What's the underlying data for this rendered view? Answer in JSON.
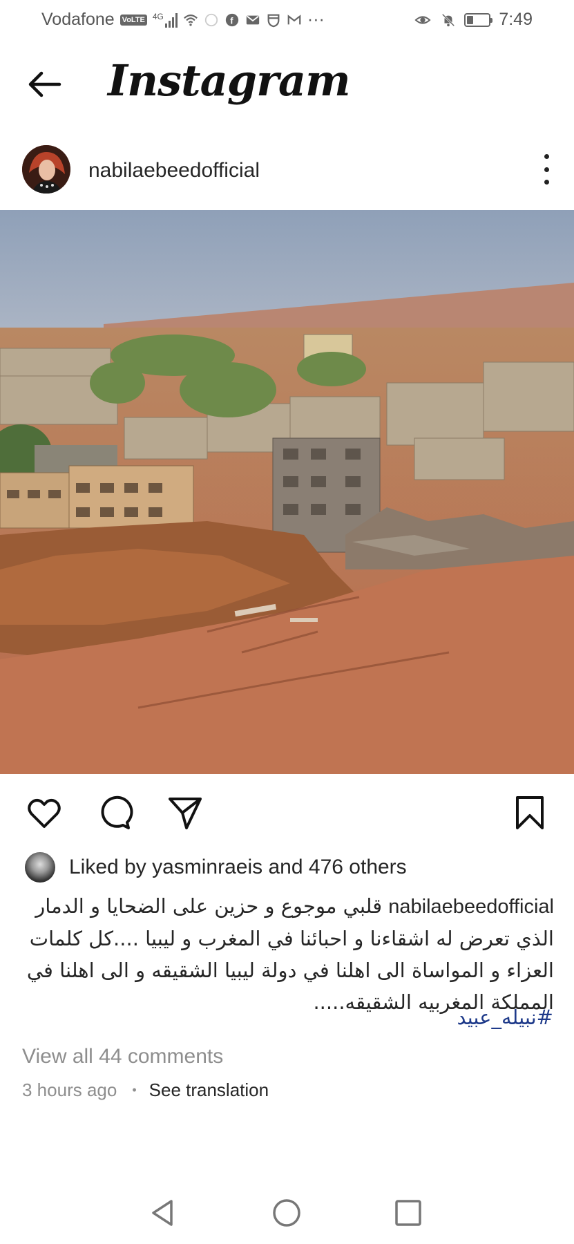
{
  "status_bar": {
    "carrier": "Vodafone",
    "volte": "VoLTE",
    "network": "4G",
    "time": "7:49"
  },
  "header": {
    "title": "Instagram",
    "back_icon": "back-arrow-icon"
  },
  "post": {
    "username": "nabilaebeedofficial",
    "more_icon": "more-vertical-icon",
    "image_description_icon": "post-photo",
    "actions": {
      "like_icon": "heart-icon",
      "comment_icon": "comment-icon",
      "share_icon": "share-icon",
      "save_icon": "bookmark-icon"
    },
    "likes": {
      "prefix": "Liked by",
      "user": "yasminraeis",
      "middle": "and",
      "others": "476 others"
    },
    "caption": {
      "username": "nabilaebeedofficial",
      "text": "قلبي موجوع و حزين على الضحايا و الدمار الذي تعرض له اشقاءنا و احبائنا في المغرب و ليبيا ....كل كلمات العزاء و المواساة الى اهلنا في دولة ليبيا الشقيقه و الى اهلنا في المملكة المغربيه الشقيقه.....",
      "hashtag": "#نبيله_عبيد"
    },
    "view_comments": "View all 44 comments",
    "time_ago": "3 hours ago",
    "separator": "•",
    "see_translation": "See translation"
  },
  "navbar": {
    "back_icon": "nav-back-icon",
    "home_icon": "nav-home-icon",
    "recents_icon": "nav-recents-icon"
  }
}
